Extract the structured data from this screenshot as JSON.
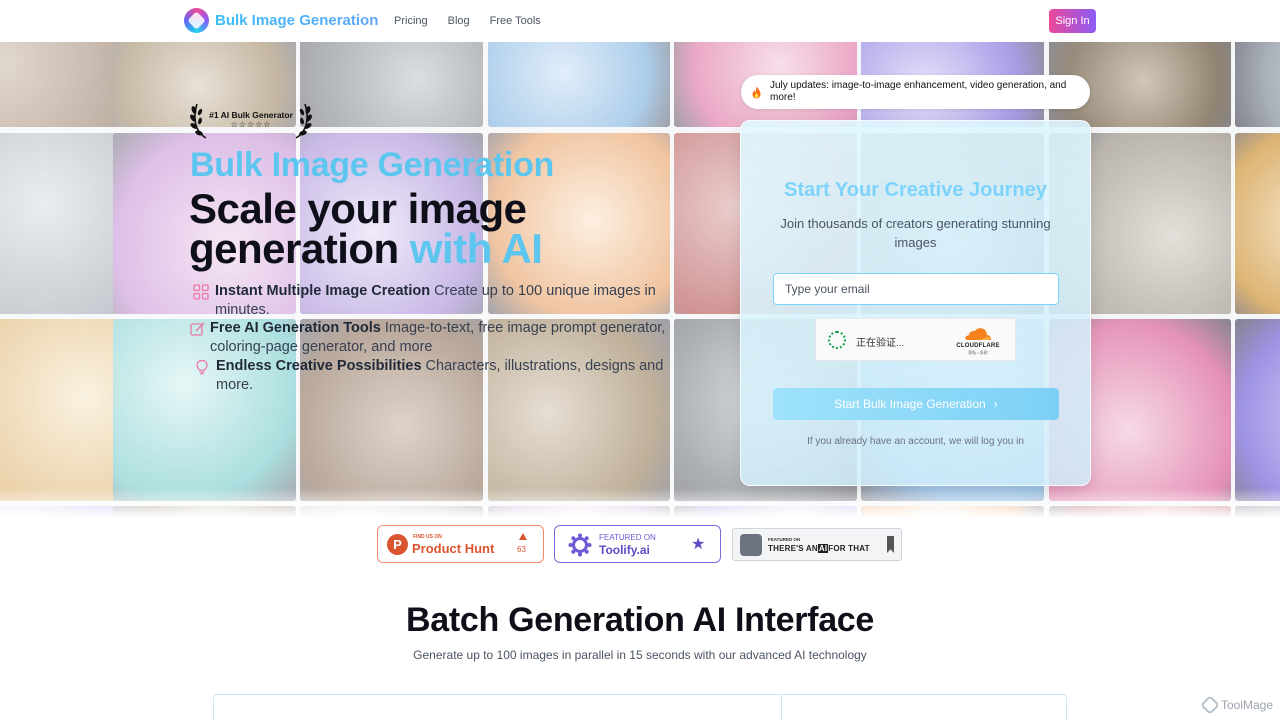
{
  "header": {
    "brand": "Bulk Image Generation",
    "nav": [
      "Pricing",
      "Blog",
      "Free Tools"
    ],
    "signin_label": "Sign In"
  },
  "hero": {
    "award_title": "#1 AI Bulk Generator",
    "award_stars": "☆☆☆☆☆",
    "headline_accent": "Bulk Image Generation",
    "headline_line1": "Scale your image",
    "headline_line2": "generation",
    "headline_ai": "with AI",
    "features": [
      {
        "title": "Instant Multiple Image Creation",
        "text": "Create up to 100 unique images in minutes.",
        "icon": "grid-icon"
      },
      {
        "title": "Free AI Generation Tools",
        "text": "Image-to-text, free image prompt generator, coloring-page generator, and more",
        "icon": "edit-icon"
      },
      {
        "title": "Endless Creative Possibilities",
        "text": "Characters, illustrations, designs and more.",
        "icon": "lightbulb-icon"
      }
    ]
  },
  "updates": {
    "text": "July updates: image-to-image enhancement, video generation, and more!"
  },
  "signup": {
    "title": "Start Your Creative Journey",
    "subtitle": "Join thousands of creators generating stunning images",
    "email_placeholder": "Type your email",
    "captcha_text": "正在验证...",
    "captcha_brand": "CLOUDFLARE",
    "captcha_links": "隐私 • 条款",
    "button_label": "Start Bulk Image Generation",
    "button_chevron": "›",
    "login_note": "If you already have an account, we will log you in"
  },
  "badges": {
    "producthunt": {
      "small": "FIND US ON",
      "name": "Product Hunt",
      "count": "63"
    },
    "toolify": {
      "small": "FEATURED ON",
      "name": "Toolify.ai",
      "star": "★"
    },
    "theresanai": {
      "small": "FEATURED ON",
      "pre": "THERE'S AN",
      "box": "AI",
      "post": "FOR THAT"
    }
  },
  "section": {
    "title": "Batch Generation AI Interface",
    "subtitle": "Generate up to 100 images in parallel in 15 seconds with our advanced AI technology"
  },
  "watermark": "ToolMage",
  "colors": {
    "accent": "#5cc6ee",
    "signin_gradient": [
      "#ec4899",
      "#8b5cf6"
    ],
    "producthunt": "#da552f",
    "toolify": "#5b4bc4"
  }
}
